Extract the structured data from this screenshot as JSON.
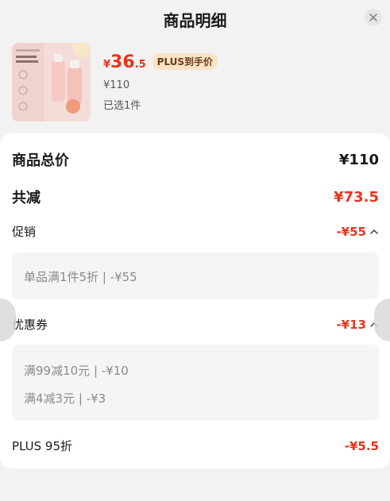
{
  "header": {
    "title": "商品明细"
  },
  "product": {
    "price_symbol": "¥",
    "price_int": "36",
    "price_dec": ".5",
    "plus_tag": "PLUS到手价",
    "orig_price": "¥110",
    "selected": "已选1件"
  },
  "summary": {
    "total_label": "商品总价",
    "total_value": "¥110",
    "discount_label": "共减",
    "discount_value": "¥73.5",
    "promo_label": "促销",
    "promo_value": "-¥55",
    "promo_items": [
      "单品满1件5折 | -¥55"
    ],
    "coupon_label": "优惠券",
    "coupon_value": "-¥13",
    "coupon_items": [
      "满99减10元 | -¥10",
      "满4减3元 | -¥3"
    ],
    "plus_label": "PLUS 95折",
    "plus_value": "-¥5.5"
  },
  "colors": {
    "accent_red": "#e8331c",
    "plus_tag_bg": "#fbe3c6"
  },
  "icons": {
    "close": "close-icon",
    "collapse": "chevron-up-icon"
  }
}
